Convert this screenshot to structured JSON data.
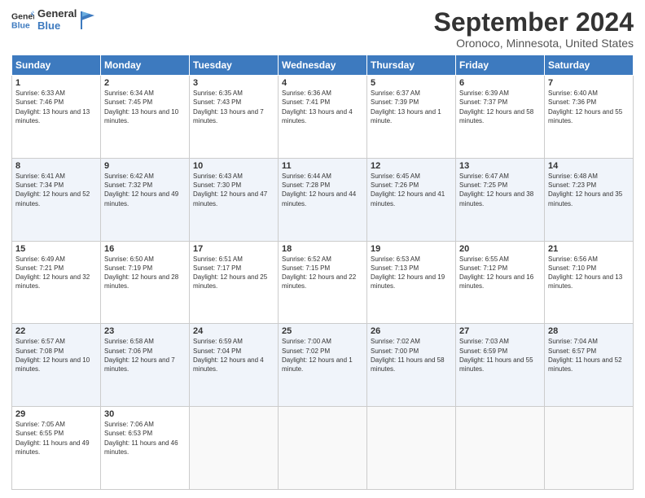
{
  "logo": {
    "line1": "General",
    "line2": "Blue"
  },
  "header": {
    "month": "September 2024",
    "location": "Oronoco, Minnesota, United States"
  },
  "weekdays": [
    "Sunday",
    "Monday",
    "Tuesday",
    "Wednesday",
    "Thursday",
    "Friday",
    "Saturday"
  ],
  "weeks": [
    [
      {
        "day": "1",
        "sunrise": "6:33 AM",
        "sunset": "7:46 PM",
        "daylight": "13 hours and 13 minutes."
      },
      {
        "day": "2",
        "sunrise": "6:34 AM",
        "sunset": "7:45 PM",
        "daylight": "13 hours and 10 minutes."
      },
      {
        "day": "3",
        "sunrise": "6:35 AM",
        "sunset": "7:43 PM",
        "daylight": "13 hours and 7 minutes."
      },
      {
        "day": "4",
        "sunrise": "6:36 AM",
        "sunset": "7:41 PM",
        "daylight": "13 hours and 4 minutes."
      },
      {
        "day": "5",
        "sunrise": "6:37 AM",
        "sunset": "7:39 PM",
        "daylight": "13 hours and 1 minute."
      },
      {
        "day": "6",
        "sunrise": "6:39 AM",
        "sunset": "7:37 PM",
        "daylight": "12 hours and 58 minutes."
      },
      {
        "day": "7",
        "sunrise": "6:40 AM",
        "sunset": "7:36 PM",
        "daylight": "12 hours and 55 minutes."
      }
    ],
    [
      {
        "day": "8",
        "sunrise": "6:41 AM",
        "sunset": "7:34 PM",
        "daylight": "12 hours and 52 minutes."
      },
      {
        "day": "9",
        "sunrise": "6:42 AM",
        "sunset": "7:32 PM",
        "daylight": "12 hours and 49 minutes."
      },
      {
        "day": "10",
        "sunrise": "6:43 AM",
        "sunset": "7:30 PM",
        "daylight": "12 hours and 47 minutes."
      },
      {
        "day": "11",
        "sunrise": "6:44 AM",
        "sunset": "7:28 PM",
        "daylight": "12 hours and 44 minutes."
      },
      {
        "day": "12",
        "sunrise": "6:45 AM",
        "sunset": "7:26 PM",
        "daylight": "12 hours and 41 minutes."
      },
      {
        "day": "13",
        "sunrise": "6:47 AM",
        "sunset": "7:25 PM",
        "daylight": "12 hours and 38 minutes."
      },
      {
        "day": "14",
        "sunrise": "6:48 AM",
        "sunset": "7:23 PM",
        "daylight": "12 hours and 35 minutes."
      }
    ],
    [
      {
        "day": "15",
        "sunrise": "6:49 AM",
        "sunset": "7:21 PM",
        "daylight": "12 hours and 32 minutes."
      },
      {
        "day": "16",
        "sunrise": "6:50 AM",
        "sunset": "7:19 PM",
        "daylight": "12 hours and 28 minutes."
      },
      {
        "day": "17",
        "sunrise": "6:51 AM",
        "sunset": "7:17 PM",
        "daylight": "12 hours and 25 minutes."
      },
      {
        "day": "18",
        "sunrise": "6:52 AM",
        "sunset": "7:15 PM",
        "daylight": "12 hours and 22 minutes."
      },
      {
        "day": "19",
        "sunrise": "6:53 AM",
        "sunset": "7:13 PM",
        "daylight": "12 hours and 19 minutes."
      },
      {
        "day": "20",
        "sunrise": "6:55 AM",
        "sunset": "7:12 PM",
        "daylight": "12 hours and 16 minutes."
      },
      {
        "day": "21",
        "sunrise": "6:56 AM",
        "sunset": "7:10 PM",
        "daylight": "12 hours and 13 minutes."
      }
    ],
    [
      {
        "day": "22",
        "sunrise": "6:57 AM",
        "sunset": "7:08 PM",
        "daylight": "12 hours and 10 minutes."
      },
      {
        "day": "23",
        "sunrise": "6:58 AM",
        "sunset": "7:06 PM",
        "daylight": "12 hours and 7 minutes."
      },
      {
        "day": "24",
        "sunrise": "6:59 AM",
        "sunset": "7:04 PM",
        "daylight": "12 hours and 4 minutes."
      },
      {
        "day": "25",
        "sunrise": "7:00 AM",
        "sunset": "7:02 PM",
        "daylight": "12 hours and 1 minute."
      },
      {
        "day": "26",
        "sunrise": "7:02 AM",
        "sunset": "7:00 PM",
        "daylight": "11 hours and 58 minutes."
      },
      {
        "day": "27",
        "sunrise": "7:03 AM",
        "sunset": "6:59 PM",
        "daylight": "11 hours and 55 minutes."
      },
      {
        "day": "28",
        "sunrise": "7:04 AM",
        "sunset": "6:57 PM",
        "daylight": "11 hours and 52 minutes."
      }
    ],
    [
      {
        "day": "29",
        "sunrise": "7:05 AM",
        "sunset": "6:55 PM",
        "daylight": "11 hours and 49 minutes."
      },
      {
        "day": "30",
        "sunrise": "7:06 AM",
        "sunset": "6:53 PM",
        "daylight": "11 hours and 46 minutes."
      },
      null,
      null,
      null,
      null,
      null
    ]
  ]
}
